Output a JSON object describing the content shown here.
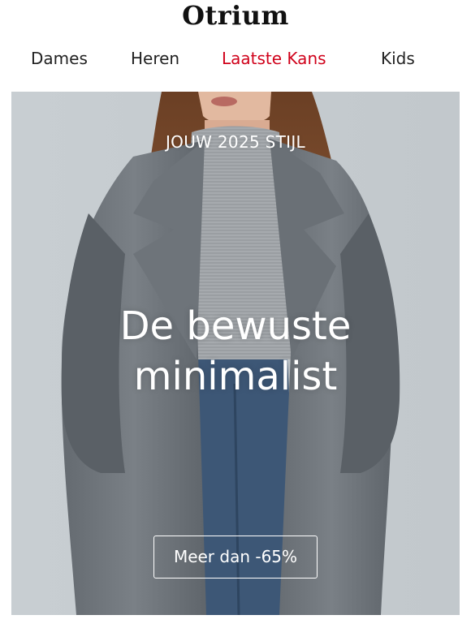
{
  "header": {
    "logo_text": "Otrium"
  },
  "nav": {
    "items": [
      {
        "label": "Dames"
      },
      {
        "label": "Heren"
      },
      {
        "label": "Laatste Kans"
      },
      {
        "label": "Kids"
      }
    ],
    "sale_color": "#d0021b"
  },
  "hero": {
    "eyebrow": "JOUW 2025 STIJL",
    "headline_line1": "De bewuste",
    "headline_line2": "minimalist",
    "cta_label": "Meer dan -65%",
    "image_subject": "model-wearing-grey-wool-coat"
  }
}
